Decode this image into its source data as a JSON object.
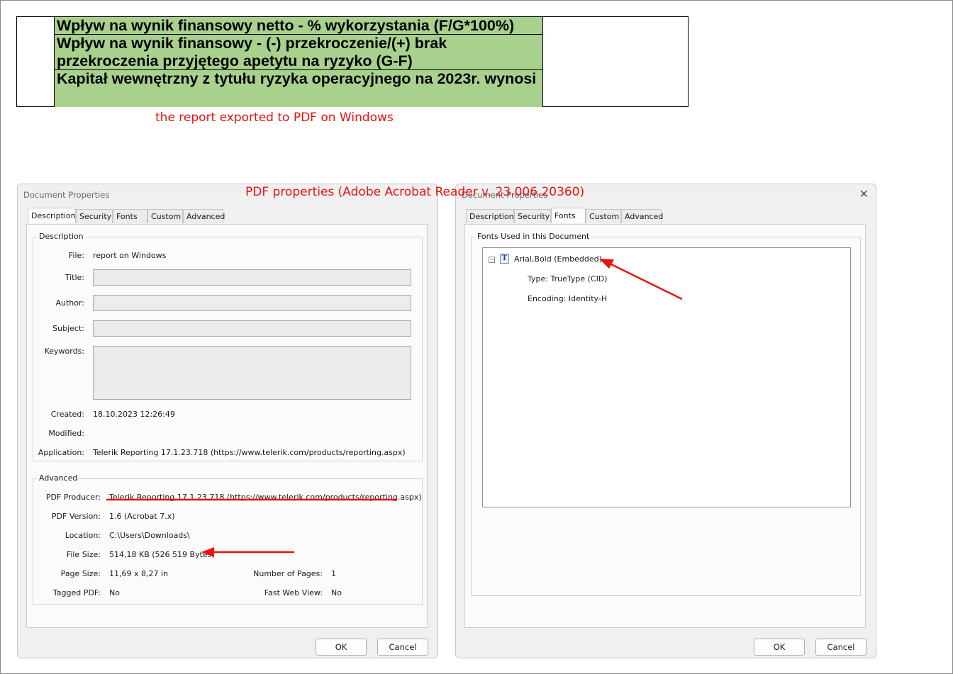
{
  "report": {
    "rows": [
      "Wpływ na wynik finansowy netto - % wykorzystania (F/G*100%)",
      "Wpływ na wynik finansowy - (-) przekroczenie/(+) brak przekroczenia przyjętego apetytu na ryzyko (G-F)",
      "Kapitał wewnętrzny z tytułu ryzyka operacyjnego na 2023r. wynosi"
    ],
    "fill_color": "#a9d18e"
  },
  "captions": {
    "export_note": "the report exported to PDF on Windows",
    "properties_note": "PDF properties (Adobe Acrobat Reader v. 23.006.20360)",
    "color": "#e8130f"
  },
  "dialog_left": {
    "title": "Document Properties",
    "tabs": [
      "Description",
      "Security",
      "Fonts",
      "Custom",
      "Advanced"
    ],
    "active_tab": "Description",
    "description_group": "Description",
    "fields": {
      "file_label": "File:",
      "file_value": "report on Windows",
      "title_label": "Title:",
      "title_value": "",
      "author_label": "Author:",
      "author_value": "",
      "subject_label": "Subject:",
      "subject_value": "",
      "keywords_label": "Keywords:",
      "keywords_value": "",
      "created_label": "Created:",
      "created_value": "18.10.2023 12:26:49",
      "modified_label": "Modified:",
      "modified_value": "",
      "application_label": "Application:",
      "application_value": "Telerik Reporting 17.1.23.718 (https://www.telerik.com/products/reporting.aspx)"
    },
    "advanced_group": "Advanced",
    "advanced": {
      "producer_label": "PDF Producer:",
      "producer_value": "Telerik Reporting 17.1.23.718 (https://www.telerik.com/products/reporting.aspx)",
      "version_label": "PDF Version:",
      "version_value": "1.6 (Acrobat 7.x)",
      "location_label": "Location:",
      "location_value": "C:\\Users\\Downloads\\",
      "filesize_label": "File Size:",
      "filesize_value": "514,18 KB (526 519 Bytes)",
      "pagesize_label": "Page Size:",
      "pagesize_value": "11,69 x 8,27 in",
      "pages_label": "Number of Pages:",
      "pages_value": "1",
      "tagged_label": "Tagged PDF:",
      "tagged_value": "No",
      "fastweb_label": "Fast Web View:",
      "fastweb_value": "No"
    },
    "ok": "OK",
    "cancel": "Cancel"
  },
  "dialog_right": {
    "title": "Document Properties",
    "close": "✕",
    "tabs": [
      "Description",
      "Security",
      "Fonts",
      "Custom",
      "Advanced"
    ],
    "active_tab": "Fonts",
    "fonts_group": "Fonts Used in this Document",
    "font_entry": "Arial,Bold (Embedded)",
    "font_type": "Type: TrueType (CID)",
    "font_encoding": "Encoding: Identity-H",
    "font_icon_glyph": "T",
    "expander_glyph": "−",
    "ok": "OK",
    "cancel": "Cancel"
  }
}
